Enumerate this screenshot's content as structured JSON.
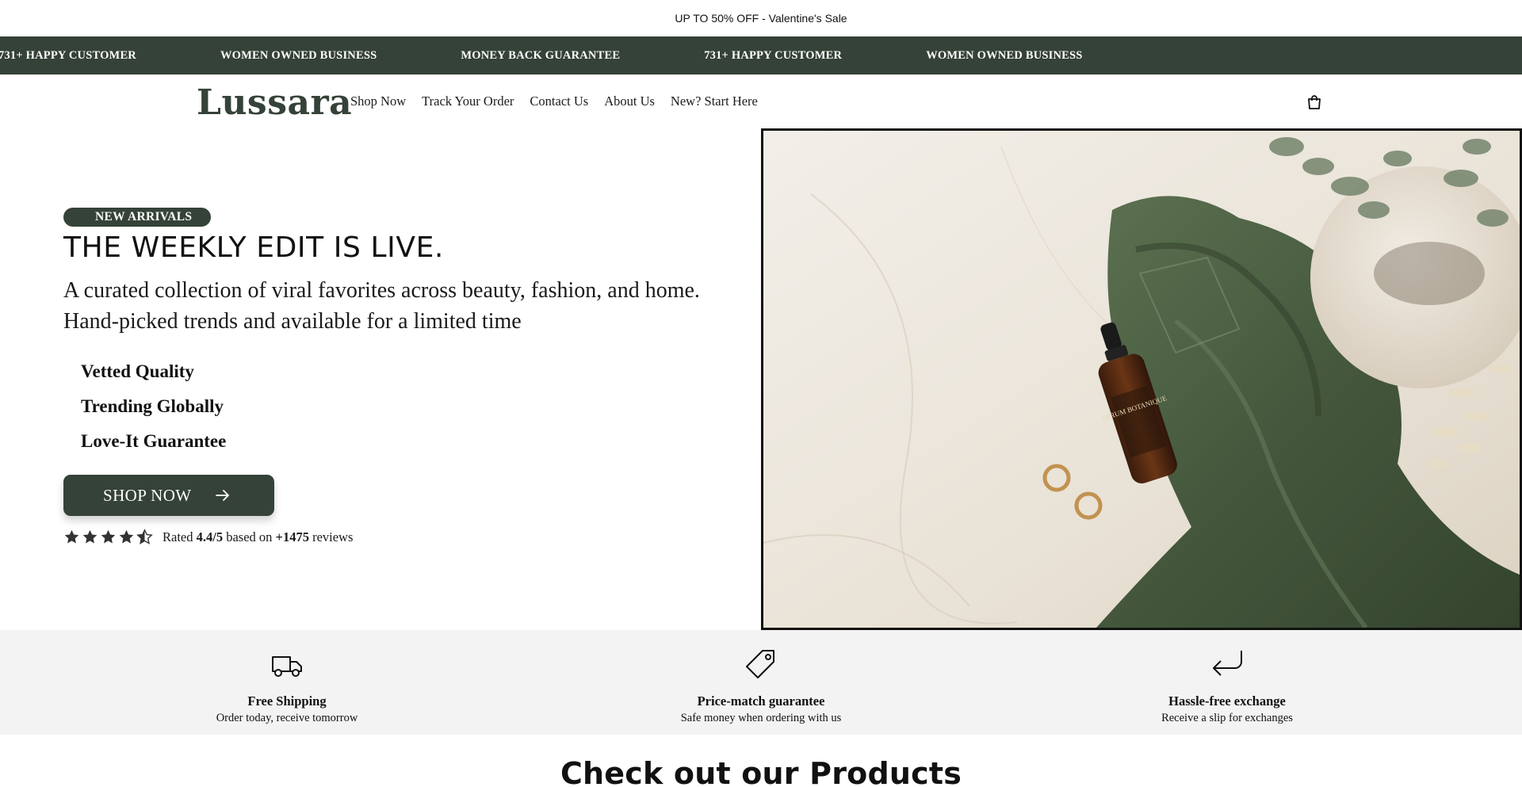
{
  "announcement": {
    "text": "UP TO 50% OFF - Valentine's Sale"
  },
  "marquee": {
    "items": [
      "731+ HAPPY CUSTOMER",
      "WOMEN OWNED BUSINESS",
      "MONEY BACK GUARANTEE",
      "731+ HAPPY CUSTOMER",
      "WOMEN OWNED BUSINESS"
    ]
  },
  "header": {
    "logo": "Lussara",
    "nav": [
      "Shop Now",
      "Track Your Order",
      "Contact Us",
      "About Us",
      "New? Start Here"
    ],
    "cart_icon": "shopping-bag-icon"
  },
  "hero": {
    "badge": "NEW ARRIVALS",
    "headline": "THE WEEKLY EDIT IS LIVE.",
    "subhead": "A curated collection of viral favorites across beauty, fashion, and home. Hand-picked trends and available for a limited time",
    "features": [
      "Vetted Quality",
      "Trending Globally",
      "Love-It Guarantee"
    ],
    "cta": "SHOP NOW",
    "rating": {
      "prefix": "Rated",
      "score": "4.4/5",
      "middle": "based on",
      "count": "+1475",
      "suffix": "reviews",
      "stars": 4.5
    },
    "image_alt": "Serum Botanique bottle on green silk scarf with gold earrings and eucalyptus",
    "product_label": "SERUM BOTANIQUE"
  },
  "benefits": [
    {
      "icon": "truck-icon",
      "title": "Free Shipping",
      "desc": "Order today, receive tomorrow"
    },
    {
      "icon": "tag-icon",
      "title": "Price-match guarantee",
      "desc": "Safe money when ordering with us"
    },
    {
      "icon": "return-arrow-icon",
      "title": "Hassle-free exchange",
      "desc": "Receive a slip for exchanges"
    }
  ],
  "products": {
    "title": "Check out our Products"
  },
  "colors": {
    "brand": "#354238",
    "bar_bg": "#f3f3f3",
    "marble": "#ede7dd",
    "silk_green": "#4a5e42"
  }
}
